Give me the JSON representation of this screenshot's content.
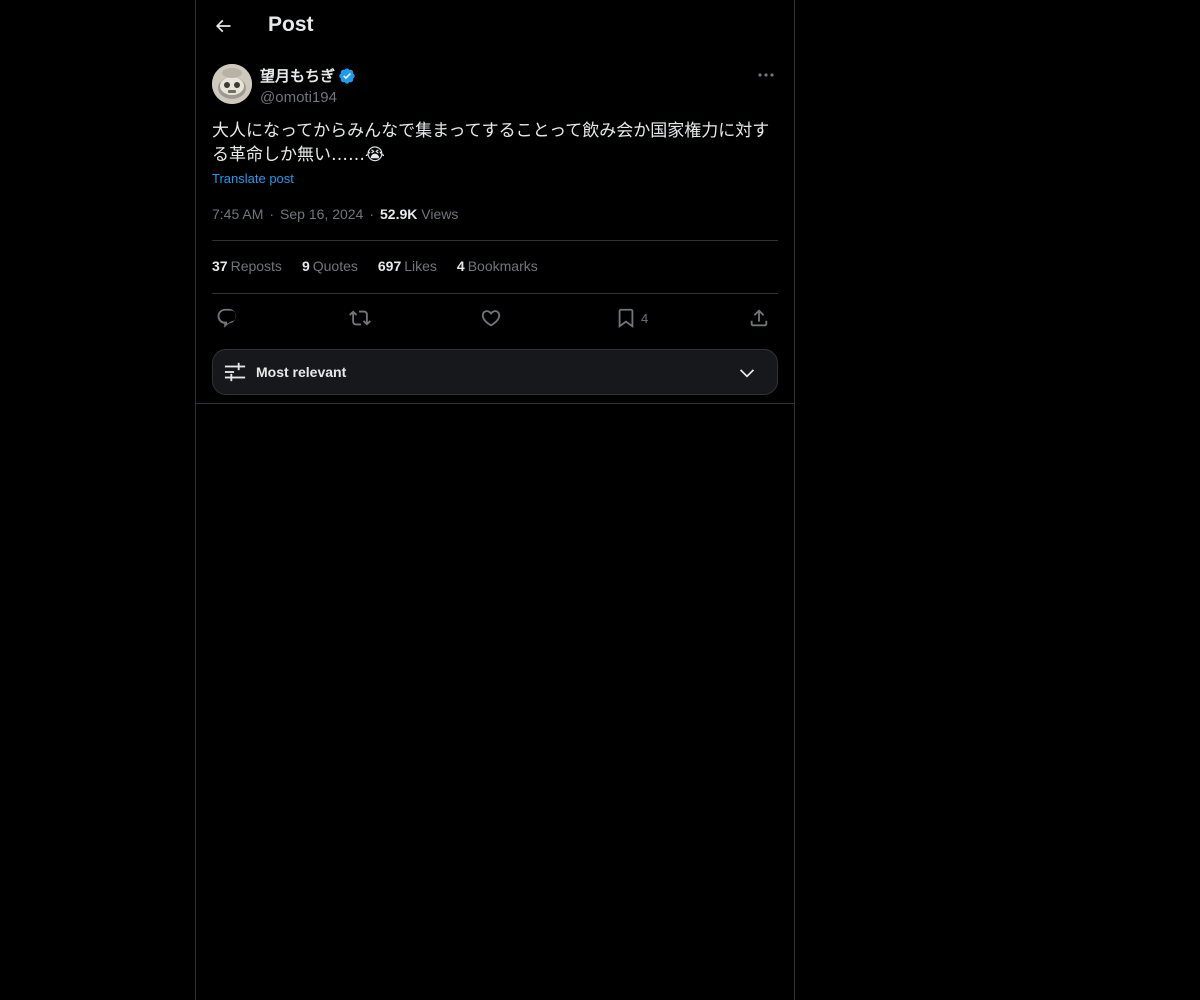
{
  "header": {
    "title": "Post",
    "back_icon": "arrow-left-icon"
  },
  "author": {
    "display_name": "望月もちぎ",
    "handle": "@omoti194",
    "verified": true,
    "verified_color": "#1d9bf0"
  },
  "post": {
    "text": "大人になってからみんなで集まってすることって飲み会か国家権力に対する革命しか無い……😭",
    "translate_label": "Translate post",
    "time": "7:45 AM",
    "date": "Sep 16, 2024",
    "views_count": "52.9K",
    "views_label": "Views",
    "separator": "·"
  },
  "stats": [
    {
      "count": "37",
      "label": "Reposts"
    },
    {
      "count": "9",
      "label": "Quotes"
    },
    {
      "count": "697",
      "label": "Likes"
    },
    {
      "count": "4",
      "label": "Bookmarks"
    }
  ],
  "actions": {
    "reply_icon": "reply-icon",
    "repost_icon": "repost-icon",
    "like_icon": "heart-icon",
    "bookmark_icon": "bookmark-icon",
    "bookmark_count": "4",
    "share_icon": "share-icon"
  },
  "sort": {
    "label": "Most relevant",
    "icon": "sliders-icon",
    "chevron": "chevron-down-icon"
  },
  "colors": {
    "background": "#000000",
    "text": "#e7e9ea",
    "muted": "#71767b",
    "accent": "#1d9bf0",
    "border": "#2f3336"
  }
}
